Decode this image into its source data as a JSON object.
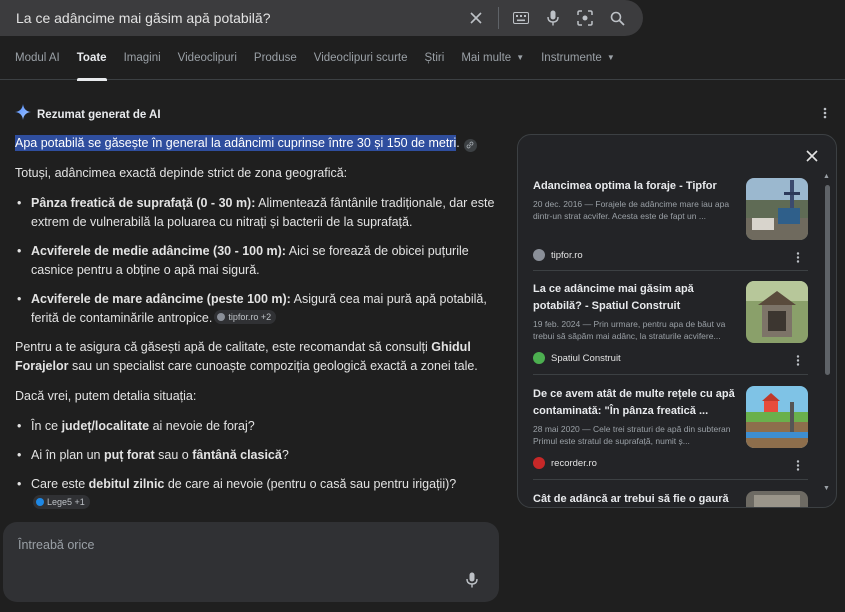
{
  "search": {
    "query": "La ce adâncime mai găsim apă potabilă?",
    "icons": [
      "close-icon",
      "keyboard-icon",
      "mic-icon",
      "lens-icon",
      "search-icon"
    ]
  },
  "tabs": [
    {
      "label": "Modul AI"
    },
    {
      "label": "Toate",
      "active": true
    },
    {
      "label": "Imagini"
    },
    {
      "label": "Videoclipuri"
    },
    {
      "label": "Produse"
    },
    {
      "label": "Videoclipuri scurte"
    },
    {
      "label": "Știri"
    },
    {
      "label": "Mai multe"
    },
    {
      "label": "Instrumente"
    }
  ],
  "ai": {
    "title": "Rezumat generat de AI",
    "highlight": "Apa potabilă se găsește în general la adâncimi cuprinse între 30 și 150 de metri",
    "intro": "Totuși, adâncimea exactă depinde strict de zona geografică:",
    "bullets": [
      {
        "bold": "Pânza freatică de suprafață (0 - 30 m):",
        "text": " Alimentează fântânile tradiționale, dar este extrem de vulnerabilă la poluarea cu nitrați și bacterii de la suprafață."
      },
      {
        "bold": "Acviferele de medie adâncime (30 - 100 m):",
        "text": " Aici se forează de obicei puțurile casnice pentru a obține o apă mai sigură."
      },
      {
        "bold": "Acviferele de mare adâncime (peste 100 m):",
        "text": " Asigură cea mai pură apă potabilă, ferită de contaminările antropice.",
        "chip": "tipfor.ro +2"
      }
    ],
    "advice_pre": "Pentru a te asigura că găsești apă de calitate, este recomandat să consulți ",
    "advice_bold": "Ghidul Forajelor",
    "advice_post": " sau un specialist care cunoaște compoziția geologică exactă a zonei tale.",
    "followup": "Dacă vrei, putem detalia situația:",
    "questions": [
      {
        "pre": "În ce ",
        "bold": "județ/localitate",
        "post": " ai nevoie de foraj?"
      },
      {
        "pre": "Ai în plan un ",
        "bold": "puț forat",
        "mid": " sau o ",
        "bold2": "fântână clasică",
        "post": "?"
      },
      {
        "pre": "Care este ",
        "bold": "debitul zilnic",
        "post": " de care ai nevoie (pentru o casă sau pentru irigații)?",
        "chip": "Lege5 +1"
      }
    ]
  },
  "ask": {
    "placeholder": "Întreabă orice"
  },
  "sources": [
    {
      "title": "Adancimea optima la foraje - Tipfor",
      "snippet": "20 dec. 2016 — Forajele de adâncime mare iau apa dintr-un strat acvifer. Acesta este de fapt un ...",
      "site": "tipfor.ro",
      "fav_color": "#8a8f98"
    },
    {
      "title": "La ce adâncime mai găsim apă potabilă? - Spatiul Construit",
      "snippet": "19 feb. 2024 — Prin urmare, pentru apa de băut va trebui să săpăm mai adânc, la straturile acvifere...",
      "site": "Spatiul Construit",
      "fav_color": "#4caf50"
    },
    {
      "title": "De ce avem atât de multe rețele cu apă contaminată: \"În pânza freatică ...",
      "snippet": "28 mai 2020 — Cele trei straturi de apă din subteran Primul este stratul de suprafață, numit ș...",
      "site": "recorder.ro",
      "fav_color": "#c62828"
    },
    {
      "title": "Cât de adâncă ar trebui să fie o gaură"
    }
  ]
}
